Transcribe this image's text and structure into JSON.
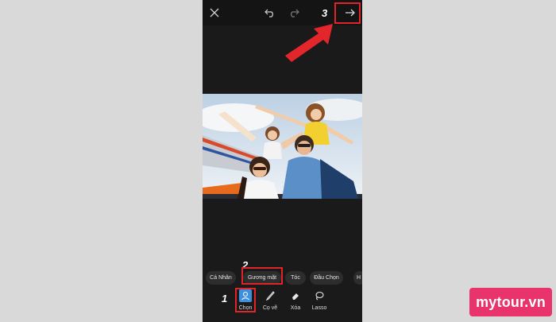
{
  "topbar": {
    "icons": [
      "close-icon",
      "undo-icon",
      "redo-icon",
      "arrow-right-icon"
    ]
  },
  "annotations": {
    "step3": "3",
    "step2": "2",
    "step1": "1",
    "highlight_color": "#e0252a"
  },
  "photo": {
    "description_hidden": true
  },
  "categories": [
    "Cá Nhân",
    "Gương mặt",
    "Tóc",
    "Đầu Chọn",
    "H"
  ],
  "tools": [
    {
      "label": "Chọn",
      "icon": "person-select-icon"
    },
    {
      "label": "Cọ vẽ",
      "icon": "brush-icon"
    },
    {
      "label": "Xóa",
      "icon": "eraser-icon"
    },
    {
      "label": "Lasso",
      "icon": "lasso-icon"
    }
  ],
  "brand": {
    "text": "mytour.vn",
    "color": "#e8336d"
  }
}
